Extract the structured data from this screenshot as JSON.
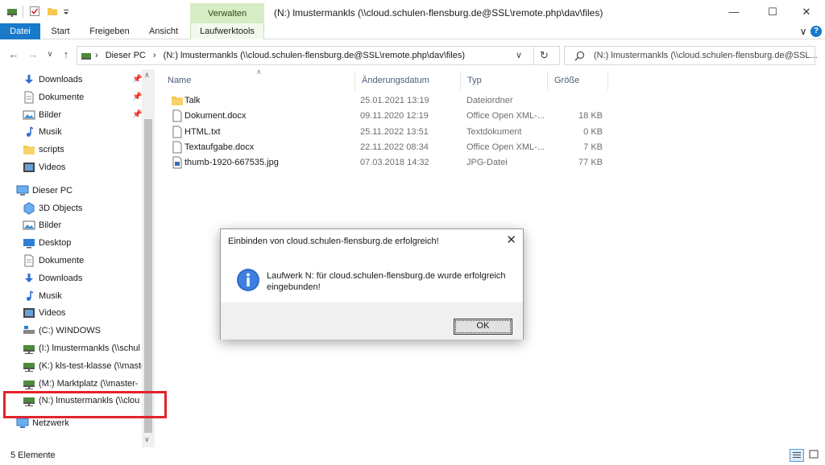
{
  "window": {
    "title": "(N:) lmustermankls (\\\\cloud.schulen-flensburg.de@SSL\\remote.php\\dav\\files)",
    "minimize": "—",
    "maximize": "☐",
    "close": "✕",
    "help": "?",
    "collapse": "∨"
  },
  "ribbon": {
    "context_header": "Verwalten",
    "tabs": [
      "Datei",
      "Start",
      "Freigeben",
      "Ansicht",
      "Laufwerktools"
    ]
  },
  "nav": {
    "back": "←",
    "forward": "→",
    "recent": "∨",
    "up": "↑",
    "path_root": "Dieser PC",
    "path_sep": "›",
    "path_drive": "(N:) lmustermankls (\\\\cloud.schulen-flensburg.de@SSL\\remote.php\\dav\\files)",
    "dropdown": "∨",
    "refresh": "↻",
    "search_placeholder": "(N:) lmustermankls (\\\\cloud.schulen-flensburg.de@SSL..."
  },
  "sidebar": {
    "quick": [
      {
        "label": "Downloads",
        "icon": "download-icon",
        "pinned": true
      },
      {
        "label": "Dokumente",
        "icon": "document-icon",
        "pinned": true
      },
      {
        "label": "Bilder",
        "icon": "pictures-icon",
        "pinned": true
      },
      {
        "label": "Musik",
        "icon": "music-icon",
        "pinned": false
      },
      {
        "label": "scripts",
        "icon": "folder-icon",
        "pinned": false
      },
      {
        "label": "Videos",
        "icon": "video-icon",
        "pinned": false
      }
    ],
    "this_pc": "Dieser PC",
    "pc_items": [
      {
        "label": "3D Objects",
        "icon": "3d-objects-icon"
      },
      {
        "label": "Bilder",
        "icon": "pictures-icon"
      },
      {
        "label": "Desktop",
        "icon": "desktop-icon"
      },
      {
        "label": "Dokumente",
        "icon": "document-icon"
      },
      {
        "label": "Downloads",
        "icon": "download-icon"
      },
      {
        "label": "Musik",
        "icon": "music-icon"
      },
      {
        "label": "Videos",
        "icon": "video-icon"
      },
      {
        "label": "(C:) WINDOWS",
        "icon": "windows-drive-icon"
      },
      {
        "label": "(I:) lmustermankls (\\\\schul",
        "icon": "network-drive-icon"
      },
      {
        "label": "(K:) kls-test-klasse (\\\\maste",
        "icon": "network-drive-icon"
      },
      {
        "label": "(M:) Marktplatz (\\\\master-",
        "icon": "network-drive-icon"
      },
      {
        "label": "(N:) lmustermankls (\\\\clou",
        "icon": "network-drive-icon"
      }
    ],
    "network": "Netzwerk",
    "pin_glyph": "📌",
    "scroll_up": "∧",
    "scroll_down": "∨"
  },
  "columns": {
    "sort_arrow": "∧",
    "name": "Name",
    "date": "Änderungsdatum",
    "type": "Typ",
    "size": "Größe"
  },
  "files": [
    {
      "name": "Talk",
      "date": "25.01.2021 13:19",
      "type": "Dateiordner",
      "size": "",
      "icon": "folder-icon"
    },
    {
      "name": "Dokument.docx",
      "date": "09.11.2020 12:19",
      "type": "Office Open XML-...",
      "size": "18 KB",
      "icon": "file-icon"
    },
    {
      "name": "HTML.txt",
      "date": "25.11.2022 13:51",
      "type": "Textdokument",
      "size": "0 KB",
      "icon": "file-icon"
    },
    {
      "name": "Textaufgabe.docx",
      "date": "22.11.2022 08:34",
      "type": "Office Open XML-...",
      "size": "7 KB",
      "icon": "file-icon"
    },
    {
      "name": "thumb-1920-667535.jpg",
      "date": "07.03.2018 14:32",
      "type": "JPG-Datei",
      "size": "77 KB",
      "icon": "image-file-icon"
    }
  ],
  "status": {
    "count": "5 Elemente"
  },
  "dialog": {
    "title": "Einbinden von cloud.schulen-flensburg.de erfolgreich!",
    "close": "✕",
    "message": "Laufwerk N: für cloud.schulen-flensburg.de wurde erfolgreich eingebunden!",
    "ok": "OK",
    "icon": "info-icon"
  },
  "colors": {
    "accent": "#1979ca",
    "context_tab": "#d6ecc4",
    "highlight": "#e2232a",
    "folder": "#f5c74a"
  }
}
